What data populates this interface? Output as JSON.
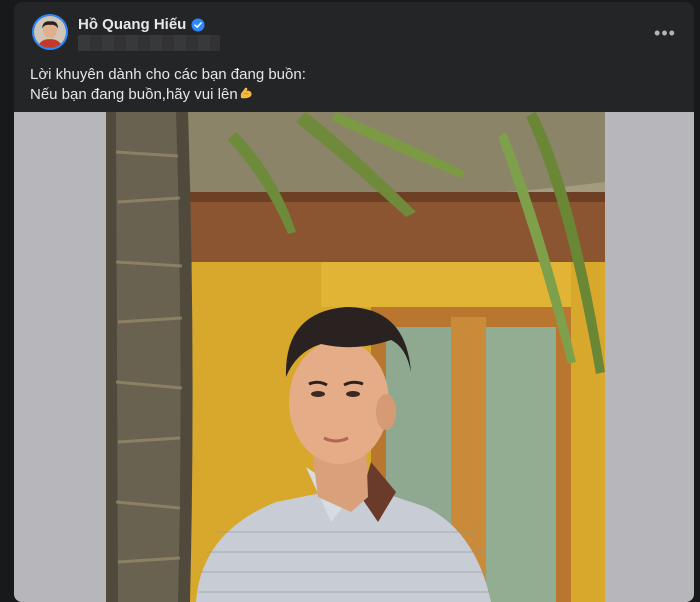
{
  "post": {
    "author_name": "Hồ Quang Hiếu",
    "verified_icon": "verified-badge-icon",
    "more_icon": "more-options-icon",
    "more_label": "•••",
    "text_line1": "Lời khuyên dành cho các bạn đang buồn:",
    "text_line2": "Nếu bạn đang buồn,hãy vui lên",
    "emoji": "flexed-biceps-emoji",
    "photo": "photo of man in checkered shirt beside palm tree"
  },
  "colors": {
    "background": "#18191a",
    "card": "#242526",
    "text": "#e4e6eb",
    "accent": "#2d88ff",
    "media_bg": "#b7b7bb"
  }
}
